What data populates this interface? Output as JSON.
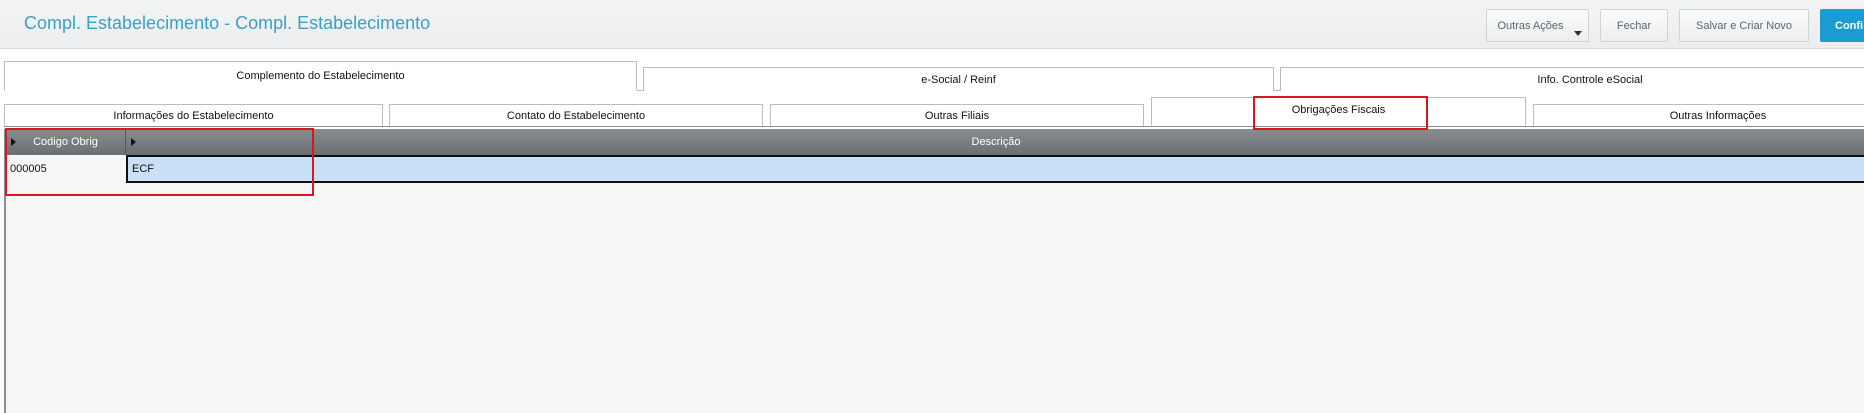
{
  "header": {
    "title": "Compl. Estabelecimento - Compl. Estabelecimento",
    "buttons": {
      "outras_acoes": "Outras Ações",
      "fechar": "Fechar",
      "salvar_criar_novo": "Salvar e Criar Novo",
      "confirmar": "Confi"
    }
  },
  "tabs_level1": [
    {
      "label": "Complemento do Estabelecimento",
      "active": true
    },
    {
      "label": "e-Social / Reinf",
      "active": false
    },
    {
      "label": "Info. Controle eSocial",
      "active": false
    }
  ],
  "tabs_level2": [
    {
      "label": "Informações do Estabelecimento",
      "active": false
    },
    {
      "label": "Contato do Estabelecimento",
      "active": false
    },
    {
      "label": "Outras Filiais",
      "active": false
    },
    {
      "label": "Obrigações Fiscais",
      "active": true
    },
    {
      "label": "Outras Informações",
      "active": false
    }
  ],
  "grid": {
    "columns": [
      "Codigo Obrig",
      "Descrição"
    ],
    "rows": [
      {
        "codigo": "000005",
        "descricao": "ECF"
      }
    ]
  },
  "colors": {
    "title": "#3aa0c6",
    "confirm_button": "#1a9bd1",
    "highlight": "#e0141e",
    "selected_cell": "#c9e1f6"
  }
}
